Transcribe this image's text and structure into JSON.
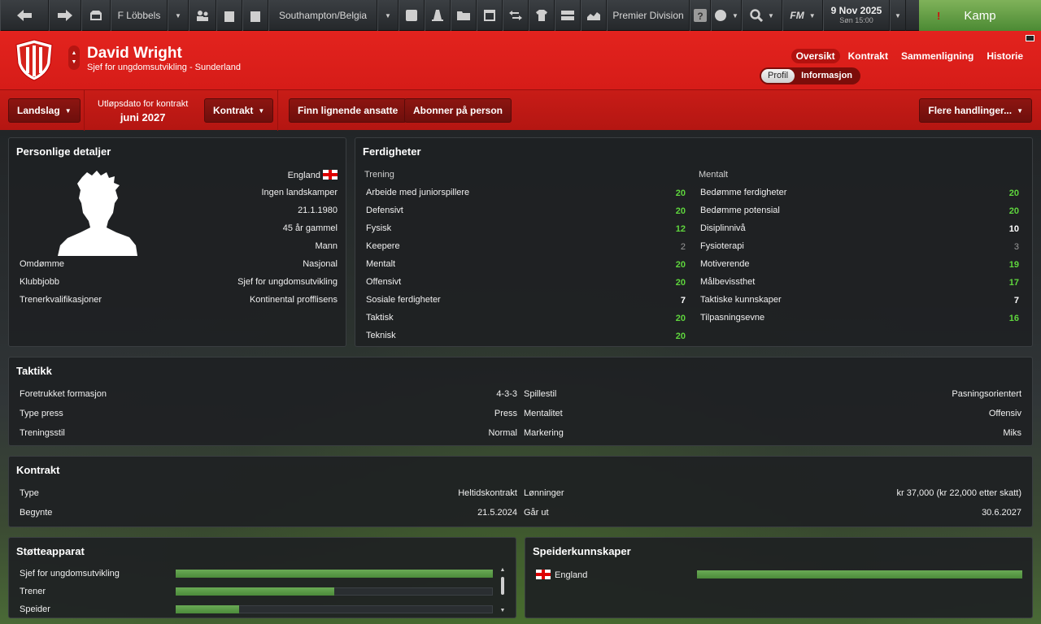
{
  "toolbar": {
    "manager": "F Löbbels",
    "club_path": "Southampton/Belgia",
    "division": "Premier Division",
    "fm_label": "FM",
    "date": "9 Nov 2025",
    "time": "Søn 15:00",
    "continue_label": "Kamp",
    "alert_mark": "!"
  },
  "header": {
    "name": "David Wright",
    "role": "Sjef for ungdomsutvikling - Sunderland",
    "tabs": [
      "Oversikt",
      "Kontrakt",
      "Sammenligning",
      "Historie"
    ],
    "subtabs": [
      "Profil",
      "Informasjon"
    ]
  },
  "actions": {
    "landslag": "Landslag",
    "expiry_label": "Utløpsdato for kontrakt",
    "expiry_value": "juni 2027",
    "kontrakt": "Kontrakt",
    "find_similar": "Finn lignende ansatte",
    "subscribe": "Abonner på person",
    "more_actions": "Flere handlinger..."
  },
  "personal": {
    "title": "Personlige detaljer",
    "nationality": "England",
    "caps": "Ingen landskamper",
    "dob": "21.1.1980",
    "age": "45 år gammel",
    "gender": "Mann",
    "rows": [
      {
        "label": "Omdømme",
        "value": "Nasjonal"
      },
      {
        "label": "Klubbjobb",
        "value": "Sjef for ungdomsutvikling"
      },
      {
        "label": "Trenerkvalifikasjoner",
        "value": "Kontinental profflisens"
      }
    ]
  },
  "skills": {
    "title": "Ferdigheter",
    "training_header": "Trening",
    "mental_header": "Mentalt",
    "training": [
      {
        "label": "Arbeide med juniorspillere",
        "value": "20"
      },
      {
        "label": "Defensivt",
        "value": "20"
      },
      {
        "label": "Fysisk",
        "value": "12"
      },
      {
        "label": "Keepere",
        "value": "2"
      },
      {
        "label": "Mentalt",
        "value": "20"
      },
      {
        "label": "Offensivt",
        "value": "20"
      },
      {
        "label": "Sosiale ferdigheter",
        "value": "7"
      },
      {
        "label": "Taktisk",
        "value": "20"
      },
      {
        "label": "Teknisk",
        "value": "20"
      }
    ],
    "mental": [
      {
        "label": "Bedømme ferdigheter",
        "value": "20"
      },
      {
        "label": "Bedømme potensial",
        "value": "20"
      },
      {
        "label": "Disiplinnivå",
        "value": "10"
      },
      {
        "label": "Fysioterapi",
        "value": "3"
      },
      {
        "label": "Motiverende",
        "value": "19"
      },
      {
        "label": "Målbevissthet",
        "value": "17"
      },
      {
        "label": "Taktiske kunnskaper",
        "value": "7"
      },
      {
        "label": "Tilpasningsevne",
        "value": "16"
      }
    ]
  },
  "tactics": {
    "title": "Taktikk",
    "left": [
      {
        "label": "Foretrukket formasjon",
        "value": "4-3-3"
      },
      {
        "label": "Type press",
        "value": "Press"
      },
      {
        "label": "Treningsstil",
        "value": "Normal"
      }
    ],
    "right": [
      {
        "label": "Spillestil",
        "value": "Pasningsorientert"
      },
      {
        "label": "Mentalitet",
        "value": "Offensiv"
      },
      {
        "label": "Markering",
        "value": "Miks"
      }
    ]
  },
  "contract": {
    "title": "Kontrakt",
    "left": [
      {
        "label": "Type",
        "value": "Heltidskontrakt"
      },
      {
        "label": "Begynte",
        "value": "21.5.2024"
      }
    ],
    "right": [
      {
        "label": "Lønninger",
        "value": "kr 37,000 (kr 22,000 etter skatt)"
      },
      {
        "label": "Går ut",
        "value": "30.6.2027"
      }
    ]
  },
  "support": {
    "title": "Støtteapparat",
    "items": [
      {
        "label": "Sjef for ungdomsutvikling",
        "level": 1.0
      },
      {
        "label": "Trener",
        "level": 0.5
      },
      {
        "label": "Speider",
        "level": 0.2
      }
    ]
  },
  "scouting": {
    "title": "Speiderkunnskaper",
    "items": [
      {
        "label": "England",
        "level": 1.0
      }
    ]
  },
  "colors": {
    "club_red": "#e3231e",
    "continue_green": "#5c9a3e",
    "attribute_high": "#5fd63d"
  }
}
